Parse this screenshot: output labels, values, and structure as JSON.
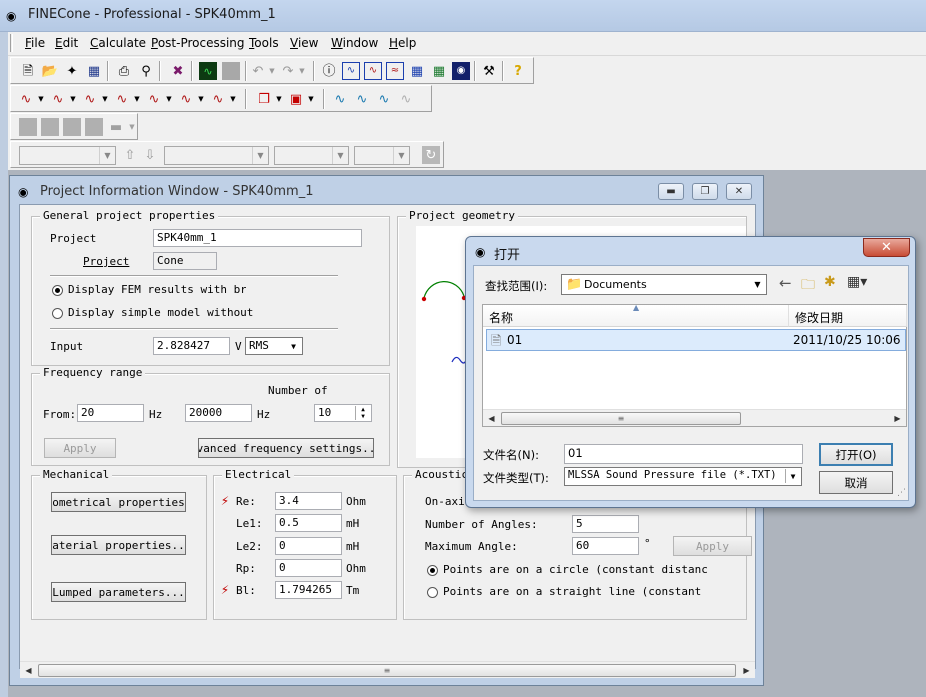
{
  "app": {
    "title": "FINECone - Professional - SPK40mm_1",
    "menu": [
      "File",
      "Edit",
      "Calculate",
      "Post-Processing",
      "Tools",
      "View",
      "Window",
      "Help"
    ],
    "menu_mnemonics": [
      "F",
      "E",
      "C",
      "P",
      "T",
      "V",
      "W",
      "H"
    ]
  },
  "project_window": {
    "title": "Project Information Window - SPK40mm_1",
    "general": {
      "group_label": "General project properties",
      "project_label": "Project",
      "project_value": "SPK40mm_1",
      "sub_project_label": "Project",
      "sub_project_value": "Cone",
      "radio_fem_label": "Display FEM results with breal",
      "radio_simple_label": "Display simple model without bre",
      "input_label": "Input",
      "input_value": "2.828427",
      "input_unit": "V",
      "input_mode": "RMS"
    },
    "frequency": {
      "group_label": "Frequency range",
      "number_of_label": "Number of",
      "from_label": "From:",
      "from_value": "20",
      "from_unit": "Hz",
      "to_value": "20000",
      "to_unit": "Hz",
      "number_value": "10",
      "apply_label": "Apply",
      "advanced_label": "dvanced frequency settings..."
    },
    "geometry": {
      "group_label": "Project geometry"
    },
    "mechanical": {
      "group_label": "Mechanical",
      "geometrical_button": "eometrical properties.",
      "material_button": "Material properties...",
      "lumped_button": "Lumped parameters..."
    },
    "electrical": {
      "group_label": "Electrical",
      "rows": [
        {
          "label": "Re:",
          "value": "3.4",
          "unit": "Ohm",
          "warn": true
        },
        {
          "label": "Le1:",
          "value": "0.5",
          "unit": "mH",
          "warn": false
        },
        {
          "label": "Le2:",
          "value": "0",
          "unit": "mH",
          "warn": false
        },
        {
          "label": "Rp:",
          "value": "0",
          "unit": "Ohm",
          "warn": false
        },
        {
          "label": "Bl:",
          "value": "1.794265",
          "unit": "Tm",
          "warn": true
        }
      ]
    },
    "acoustical": {
      "group_label": "Acoustica",
      "on_axis_label": "On-axis",
      "num_angles_label": "Number of Angles:",
      "num_angles_value": "5",
      "max_angle_label": "Maximum Angle:",
      "max_angle_value": "60",
      "degree_unit": "°",
      "apply_label": "Apply",
      "radio_circle_label": "Points are on a circle (constant distance to",
      "radio_line_label": "Points are on a straight line (constant dist"
    }
  },
  "open_dialog": {
    "title": "打开",
    "look_in_label": "查找范围(I):",
    "look_in_value": "Documents",
    "col_name": "名称",
    "col_date": "修改日期",
    "files": [
      {
        "name": "01",
        "date": "2011/10/25 10:06"
      }
    ],
    "filename_label": "文件名(N):",
    "filename_value": "01",
    "filetype_label": "文件类型(T):",
    "filetype_value": "MLSSA Sound Pressure file (*.TXT)",
    "open_button": "打开(O)",
    "cancel_button": "取消"
  },
  "colors": {
    "title_bar": "#c4d6ee",
    "dialog_frame": "#c9d9ee",
    "close_red": "#c84c35",
    "geometry_red": "#cc0000",
    "geometry_blue": "#1f2fbf"
  }
}
